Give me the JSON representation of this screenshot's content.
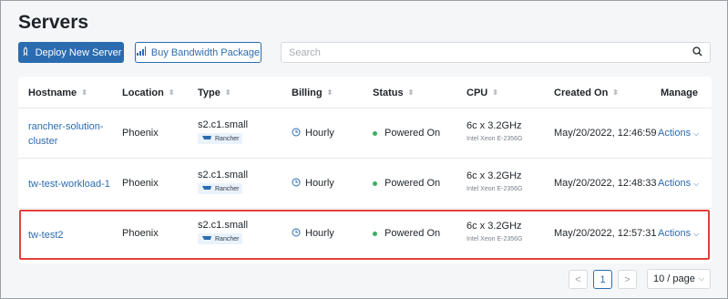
{
  "page": {
    "title": "Servers"
  },
  "toolbar": {
    "deploy_label": "Deploy New Server",
    "bandwidth_label": "Buy Bandwidth Package",
    "search_placeholder": "Search"
  },
  "table": {
    "columns": [
      "Hostname",
      "Location",
      "Type",
      "Billing",
      "Status",
      "CPU",
      "Created On",
      "Manage"
    ],
    "rows": [
      {
        "hostname": "rancher-solution-cluster",
        "location": "Phoenix",
        "type": "s2.c1.small",
        "tag": "Rancher",
        "billing": "Hourly",
        "status": "Powered On",
        "cpu": "6c x 3.2GHz",
        "cpu_model": "Intel Xeon E-2356G",
        "created": "May/20/2022, 12:46:59",
        "actions": "Actions"
      },
      {
        "hostname": "tw-test-workload-1",
        "location": "Phoenix",
        "type": "s2.c1.small",
        "tag": "Rancher",
        "billing": "Hourly",
        "status": "Powered On",
        "cpu": "6c x 3.2GHz",
        "cpu_model": "Intel Xeon E-2356G",
        "created": "May/20/2022, 12:48:33",
        "actions": "Actions"
      },
      {
        "hostname": "tw-test2",
        "location": "Phoenix",
        "type": "s2.c1.small",
        "tag": "Rancher",
        "billing": "Hourly",
        "status": "Powered On",
        "cpu": "6c x 3.2GHz",
        "cpu_model": "Intel Xeon E-2356G",
        "created": "May/20/2022, 12:57:31",
        "actions": "Actions"
      }
    ]
  },
  "pagination": {
    "prev": "<",
    "current": "1",
    "next": ">",
    "page_size": "10 / page"
  },
  "colors": {
    "accent": "#2b6cb0",
    "highlight": "#e0413b",
    "status_on": "#35b35b"
  }
}
